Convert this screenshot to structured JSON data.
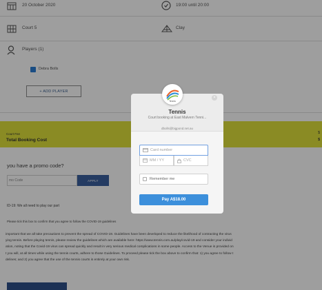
{
  "booking": {
    "date_text": "20 October 2020",
    "time_text": "19:00 until 20:00",
    "court_text": "Court 5",
    "surface_text": "Clay",
    "players_label": "Players (1)",
    "player_name": "Debra Bolls",
    "add_player_label": "+ ADD PLAYER"
  },
  "fees": {
    "court_fee_label": "Court Fee",
    "total_label": "Total Booking Cost",
    "court_fee_value": "$",
    "total_value": "$"
  },
  "promo": {
    "question": "you have a promo code?",
    "placeholder": "mo Code",
    "apply_label": "APPLY"
  },
  "covid": {
    "title": "ID-19: We all need to play our part",
    "tick_text": "Please tick this box to confirm that you agree to follow the COVID-19 guidelines",
    "paragraph_lines": [
      "important that we all take precautions to prevent the spread of COVID-19. Guidelines have been developed to reduce the likelihood of contracting the virus",
      "ying tennis. Before playing tennis, please review the guidelines which are available here: https://www.tennis.com.au/play/covid-19 and consider your individ",
      "ation, noting that the Covid-19 virus can spread quickly and result in very serious medical complications in some people. Access to the Venue is provided on",
      "t you will, at all times while using the tennis courts, adhere to those Guidelines. To proceed please tick the box above to confirm that: 1) you agree to follow t",
      "delines; and 2) you agree that the use of the tennis courts is entirely at your own risk."
    ]
  },
  "modal": {
    "logo_text": "Tennis",
    "title": "Tennis",
    "subtitle": "Court booking at East Malvern Tenni...",
    "email": "dbolls@bigpond.net.au",
    "card_placeholder": "Card number",
    "expiry_placeholder": "MM / YY",
    "cvc_placeholder": "CVC",
    "remember_label": "Remember me",
    "pay_label": "Pay A$18.00",
    "close_glyph": "×"
  },
  "colors": {
    "fee_band": "#dfe13b",
    "pay_button": "#3c8fdb",
    "apply_button": "#3a5f9e",
    "checkbox": "#2b7cd3"
  }
}
